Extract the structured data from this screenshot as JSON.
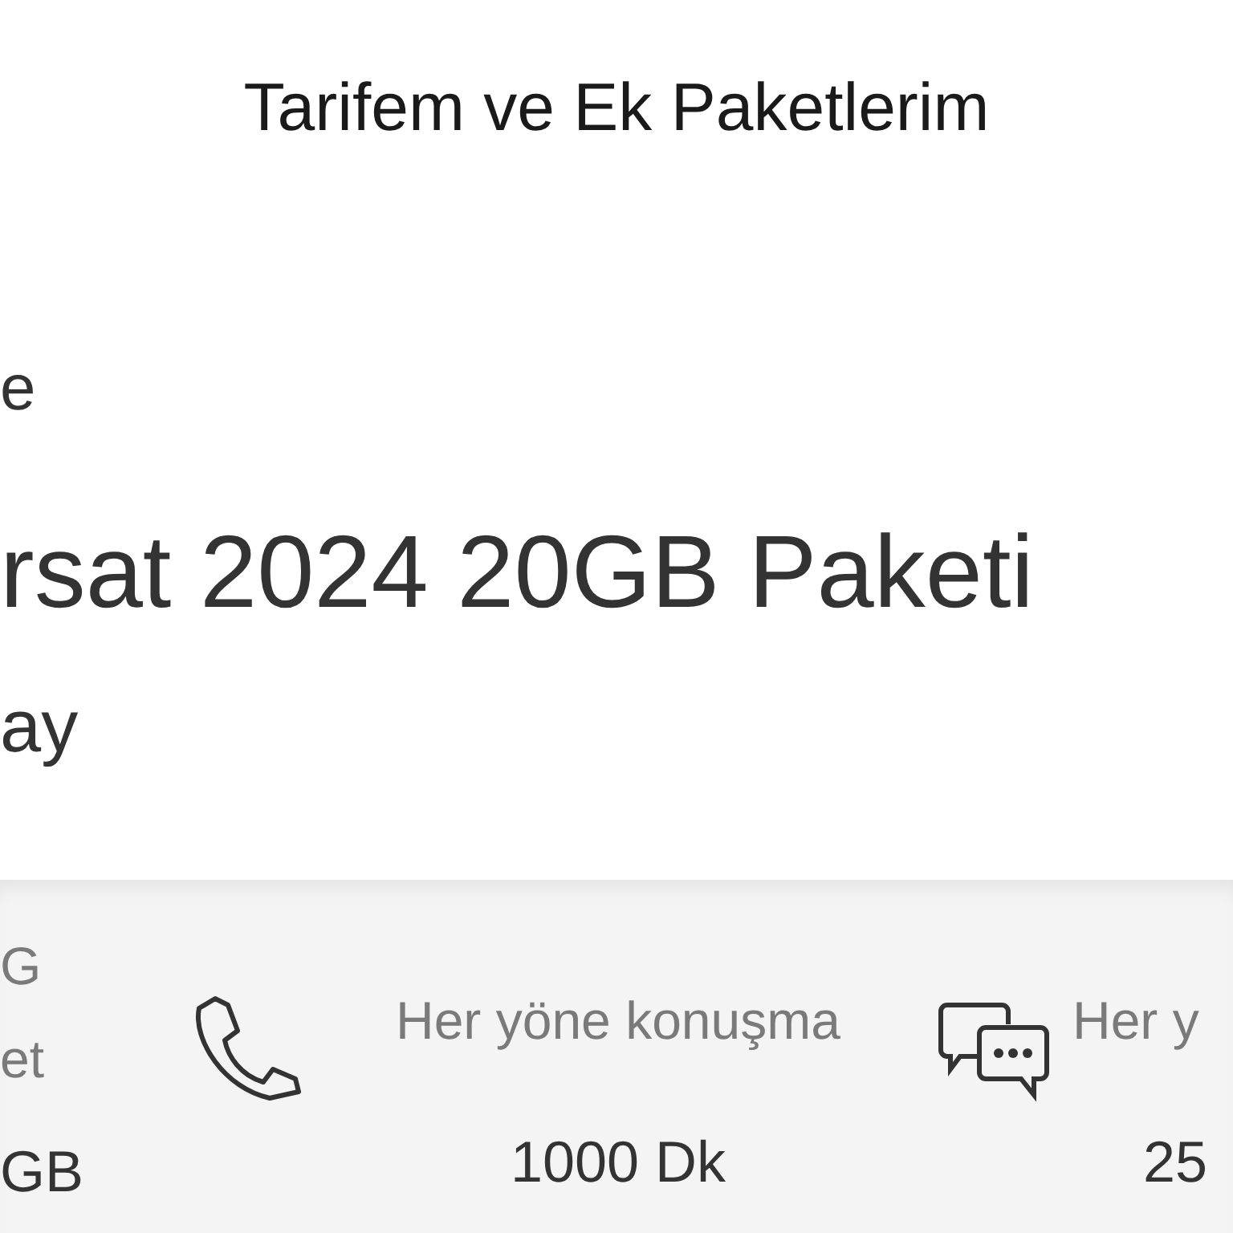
{
  "header": {
    "title": "Tarifem ve Ek Paketlerim"
  },
  "tariff": {
    "label": "e",
    "name": "rsat 2024 20GB Paketi",
    "period": "ay"
  },
  "features": [
    {
      "kind": "data",
      "lines": [
        "G",
        "et"
      ],
      "value": "GB"
    },
    {
      "kind": "call",
      "lines": [
        "Her yöne konuşma"
      ],
      "value": "1000 Dk"
    },
    {
      "kind": "sms",
      "lines": [
        "Her y"
      ],
      "value": "25"
    }
  ]
}
